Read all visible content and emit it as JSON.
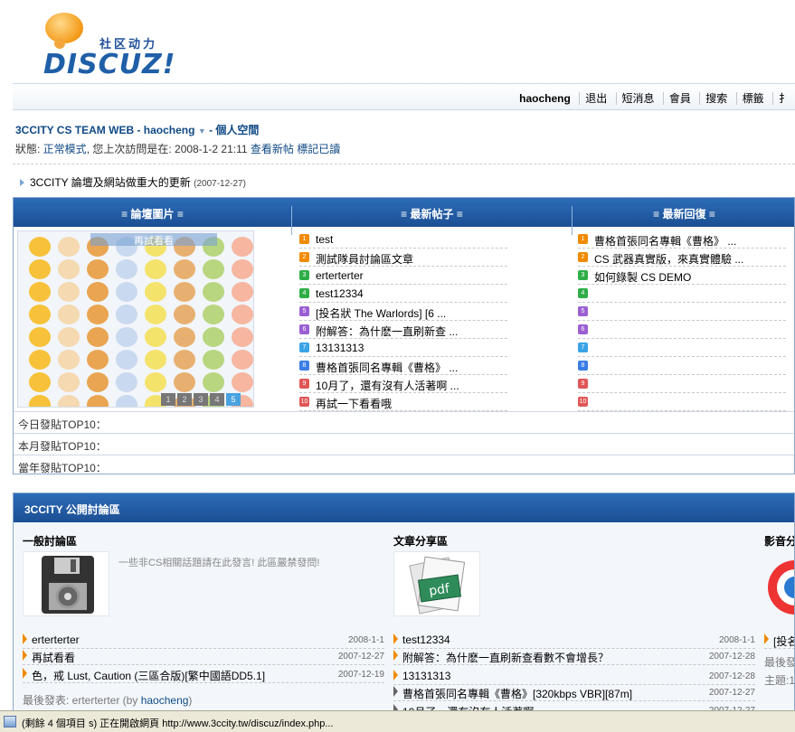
{
  "logo": {
    "cn": "社区动力",
    "en": "DISCUZ!"
  },
  "topnav": {
    "user": "haocheng",
    "items": [
      "退出",
      "短消息",
      "會員",
      "搜索",
      "標籤",
      "扌"
    ]
  },
  "welcome": {
    "site": "3CCITY CS TEAM WEB - haocheng",
    "space": " - 個人空間",
    "status_label": "狀態: ",
    "mode": "正常模式",
    "last_visit": ", 您上次訪問是在: 2008-1-2 21:11",
    "new_posts": "查看新帖",
    "mark_read": "標記已讀"
  },
  "announcement": {
    "text": "3CCITY 論壇及網站做重大的更新",
    "date": "(2007-12-27)"
  },
  "stats": {
    "headers": [
      "≡ 論壇圖片 ≡",
      "≡ 最新帖子 ≡",
      "≡ 最新回復 ≡"
    ],
    "gallery_caption": "再試看看",
    "pager": [
      "1",
      "2",
      "3",
      "4",
      "5"
    ],
    "new_posts": [
      "test",
      "測試隊員討論區文章",
      "erterterter",
      "test12334",
      "[投名狀 The Warlords] [6 ...",
      "附解答：為什麽一直刷新查 ...",
      "13131313",
      "曹格首張同名專輯《曹格》 ...",
      "10月了，還有沒有人活著啊 ...",
      "再試一下看看哦"
    ],
    "new_replies": [
      "曹格首張同名專輯《曹格》 ...",
      "CS 武器真實版，來真實體驗 ...",
      "如何錄製 CS DEMO",
      "",
      "",
      "",
      "",
      "",
      "",
      ""
    ],
    "top_rows": [
      "今日發貼TOP10：",
      "本月發貼TOP10：",
      "當年發貼TOP10："
    ]
  },
  "public": {
    "title": "3CCITY 公開討論區",
    "forums": [
      {
        "name": "一般討論區",
        "desc": "一些非CS相關話題請在此發言! 此區嚴禁發問!",
        "posts": [
          {
            "title": "erterterter",
            "date": "2008-1-1"
          },
          {
            "title": "再試看看",
            "date": "2007-12-27"
          },
          {
            "title": "色，戒 Lust, Caution (三區合版)[繁中國語DD5.1]",
            "date": "2007-12-19"
          }
        ],
        "last_label": "最後發表: erterterter (by ",
        "last_user": "haocheng",
        "last_end": ")"
      },
      {
        "name": "文章分享區",
        "desc": "",
        "posts": [
          {
            "title": "test12334",
            "date": "2008-1-1"
          },
          {
            "title": "附解答：為什麽一直刷新查看數不會增長？",
            "date": "2007-12-28"
          },
          {
            "title": "13131313",
            "date": "2007-12-28"
          },
          {
            "title": "曹格首張同名專輯《曹格》[320kbps VBR][87m]",
            "date": "2007-12-27"
          },
          {
            "title": "10月了，還有沒有人活著啊",
            "date": "2007-12-27"
          }
        ]
      },
      {
        "name": "影音分",
        "desc": "",
        "posts": [
          {
            "title": "[投名",
            "date": ""
          }
        ],
        "last_label": "最後發",
        "topic_label": "主題:1"
      }
    ]
  },
  "statusbar": {
    "text": "(剩餘 4 個項目 s) 正在開啟網頁 http://www.3ccity.tw/discuz/index.php..."
  },
  "colors": {
    "accent": "#1b4f93",
    "link": "#104a85",
    "marker": "#f08a00"
  }
}
